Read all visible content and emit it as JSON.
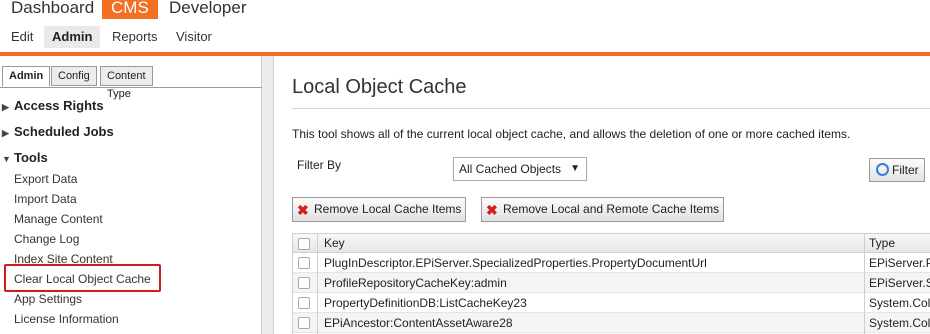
{
  "topnav": {
    "main": [
      "Dashboard",
      "CMS",
      "Developer"
    ],
    "active_main": "CMS",
    "sub": [
      "Edit",
      "Admin",
      "Reports",
      "Visitor Groups"
    ],
    "active_sub": "Admin",
    "accent_color": "#f36f21"
  },
  "leftpanel": {
    "tabs": [
      "Admin",
      "Config",
      "Content Type"
    ],
    "active_tab": "Admin",
    "sections": [
      {
        "label": "Access Rights",
        "expanded": false
      },
      {
        "label": "Scheduled Jobs",
        "expanded": false
      },
      {
        "label": "Tools",
        "expanded": true
      }
    ],
    "tools_items": [
      "Export Data",
      "Import Data",
      "Manage Content",
      "Change Log",
      "Index Site Content",
      "Clear Local Object Cache",
      "App Settings",
      "License Information"
    ],
    "highlighted_item": "Clear Local Object Cache",
    "highlight_color": "#d01c1c"
  },
  "main": {
    "title": "Local Object Cache",
    "description": "This tool shows all of the current local object cache, and allows the deletion of one or more cached items.",
    "filter_label": "Filter By",
    "filter_selected": "All Cached Objects",
    "filter_button": "Filter",
    "remove_local_button": "Remove Local Cache Items",
    "remove_remote_button": "Remove Local and Remote Cache Items",
    "table": {
      "columns": [
        "Key",
        "Type"
      ],
      "rows": [
        {
          "key": "PlugInDescriptor.EPiServer.SpecializedProperties.PropertyDocumentUrl",
          "type": "EPiServer.P"
        },
        {
          "key": "ProfileRepositoryCacheKey:admin",
          "type": "EPiServer.S"
        },
        {
          "key": "PropertyDefinitionDB:ListCacheKey23",
          "type": "System.Col"
        },
        {
          "key": "EPiAncestor:ContentAssetAware28",
          "type": "System.Col"
        }
      ]
    }
  }
}
